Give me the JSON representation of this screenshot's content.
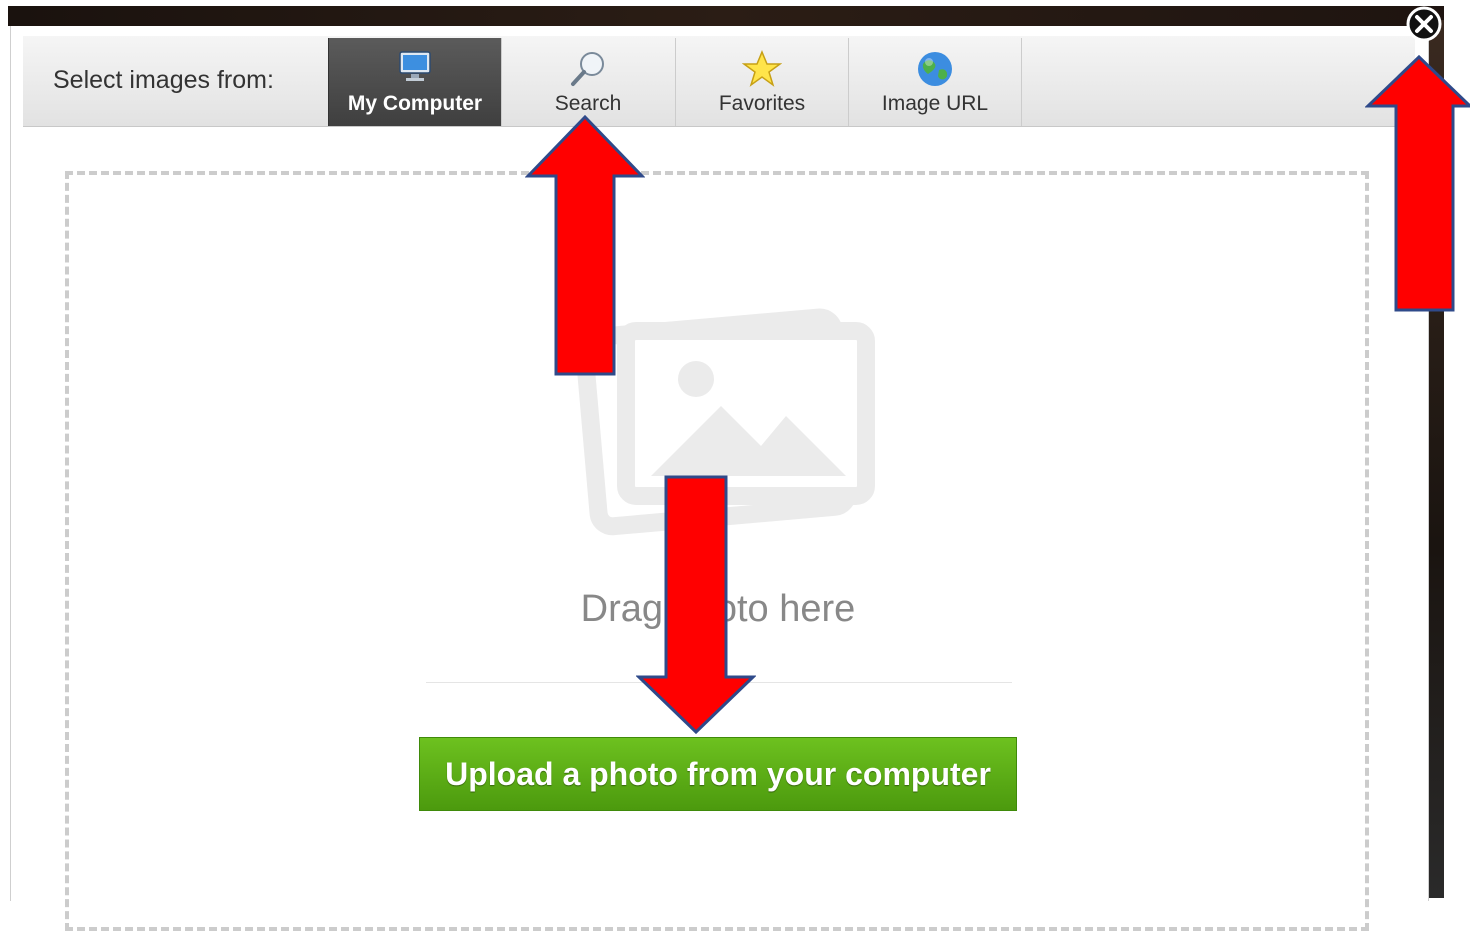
{
  "header": {
    "select_label": "Select images from:"
  },
  "tabs": [
    {
      "label": "My Computer",
      "icon": "monitor-icon",
      "active": true
    },
    {
      "label": "Search",
      "icon": "magnifier-icon",
      "active": false
    },
    {
      "label": "Favorites",
      "icon": "star-icon",
      "active": false
    },
    {
      "label": "Image URL",
      "icon": "globe-icon",
      "active": false
    }
  ],
  "dropzone": {
    "drag_text": "Drag photo here",
    "upload_label": "Upload a photo from your computer"
  },
  "close": {
    "icon": "close-icon"
  },
  "colors": {
    "upload_green": "#5aad14",
    "active_tab": "#4a4a4a",
    "annotation_arrow": "#ff0000",
    "arrow_outline": "#2f4a8a"
  }
}
